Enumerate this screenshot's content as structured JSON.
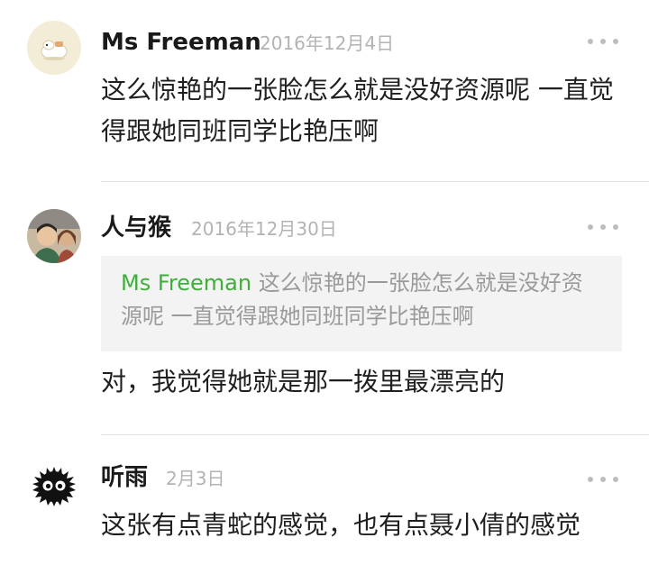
{
  "comments": [
    {
      "username": "Ms Freeman",
      "date": "2016年12月4日",
      "avatar_icon": "bear-avatar",
      "content": "这么惊艳的一张脸怎么就是没好资源呢 一直觉得跟她同班同学比艳压啊"
    },
    {
      "username": "人与猴",
      "date": "2016年12月30日",
      "avatar_icon": "photo-avatar",
      "quote": {
        "username": "Ms Freeman",
        "text": "这么惊艳的一张脸怎么就是没好资源呢 一直觉得跟她同班同学比艳压啊"
      },
      "content": "对，我觉得她就是那一拨里最漂亮的"
    },
    {
      "username": "听雨",
      "date": "2月3日",
      "avatar_icon": "soot-sprite-avatar",
      "content": "这张有点青蛇的感觉，也有点聂小倩的感觉"
    }
  ],
  "colors": {
    "quote_user": "#3fae3a",
    "date": "#b3b3b3",
    "quote_bg": "#f3f3f3"
  }
}
